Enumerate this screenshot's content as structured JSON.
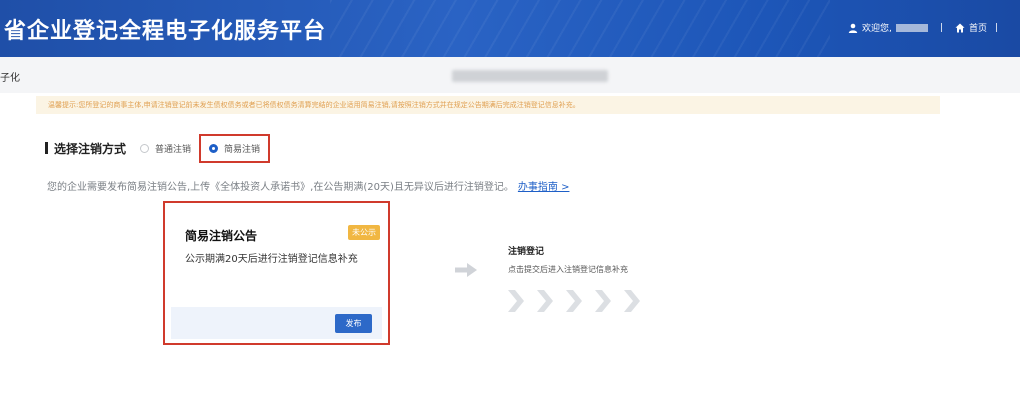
{
  "header": {
    "title": "省企业登记全程电子化服务平台",
    "welcome": "欢迎您,",
    "separator": "|",
    "home_label": "首页"
  },
  "subbar": {
    "left_text": "子化"
  },
  "notice": {
    "text": "温馨提示:您所登记的商事主体,申请注销登记前未发生债权债务或者已将债权债务清算完结的企业适用简易注销,请按照注销方式并在规定公告期满后完成注销登记信息补充。"
  },
  "select": {
    "title": "选择注销方式",
    "options": [
      {
        "label": "普通注销",
        "selected": false
      },
      {
        "label": "简易注销",
        "selected": true
      }
    ]
  },
  "description": {
    "text": "您的企业需要发布简易注销公告,上传《全体投资人承诺书》,在公告期满(20天)且无异议后进行注销登记。",
    "link": "办事指南 >"
  },
  "card": {
    "title": "简易注销公告",
    "badge": "未公示",
    "subtitle": "公示期满20天后进行注销登记信息补充",
    "button": "发布"
  },
  "step2": {
    "title": "注销登记",
    "desc": "点击提交后进入注销登记信息补充"
  },
  "colors": {
    "header_blue": "#2a63c4",
    "accent_blue": "#1e5fc7",
    "highlight_red": "#d03a2c",
    "badge_orange": "#f1b742",
    "notice_bg": "#fbf4e4"
  },
  "icons": {
    "user": "user-icon",
    "home": "home-icon",
    "arrow": "arrow-right-icon",
    "chevron": "chevron-right-icon"
  }
}
